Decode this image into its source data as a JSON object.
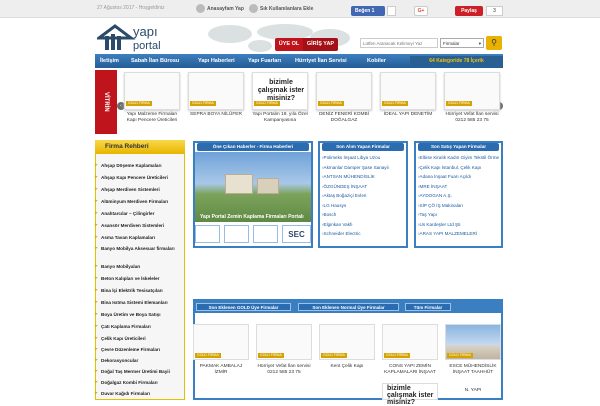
{
  "top": {
    "date": "27 Ağustos 2017 - Hoşgeldiniz",
    "homepage": "Anasayfam Yap",
    "favorites": "Sık Kullanılanlara Ekle",
    "fb_like": "Beğen 1",
    "fb_count": "",
    "gplus": "G+",
    "pin": "Paylaş",
    "pin_count": "3"
  },
  "header": {
    "uye": "ÜYE OL",
    "giris": "GİRİŞ YAP",
    "search_placeholder": "Lütfen Aranacak Kelimeyi Yaz",
    "search_select": "Firmalar",
    "category_count": "64 Kategoride 78 İçerik"
  },
  "nav": [
    "İletişim",
    "Sabah İlan Bürosu",
    "Yapı Haberleri",
    "Yapı Fuarları",
    "Hürriyet İlan Servisi",
    "Kobiler"
  ],
  "vitrin": {
    "label": "VİTRİN",
    "items": [
      {
        "name": "Yapı Malzeme Firmaları Kapı Pencere Üreticileri"
      },
      {
        "name": "SEPRA BOYA NİLÜFER"
      },
      {
        "name": "Yapı Portalın 19. yıla Özel Kampanyasına"
      },
      {
        "name": "DENİZ FENERİ KOMBİ DOĞALGAZ"
      },
      {
        "name": "İDEAL YAPI DENETİM"
      },
      {
        "name": "Hürriyet Vefat İlan servisi 0212 585 23 75"
      }
    ],
    "ad_text": "bizimle çalışmak ister misiniz?",
    "badge": "GOLD FİRMA"
  },
  "sidebar": {
    "title": "Firma Rehberi",
    "items": [
      "Ahşap Döşeme Kaplamaları",
      "Ahşap Kapı Pencere Üreticileri",
      "Ahşap Merdiven Sistemleri",
      "Alüminyum Merdiven Firmaları",
      "Anahtarcılar – Çilingirler",
      "Asansör Merdiven Sistemleri",
      "Asma Tavan Kaplamaları",
      "Banyo Mobilya Aksesuar firmaları",
      "Banyo Mobilyaları",
      "Beton Kalıpları ve İskeleler",
      "Bina İçi Elektrik Tesisatçıları",
      "Bina Isıtma Sistemi Elemanları",
      "Boya Üretim ve Boya Satışı",
      "Çatı Kaplama Firmaları",
      "Çelik Kapı Üreticileri",
      "Çevre Düzenleme Firmaları",
      "Dekorasyoncular",
      "Doğal Taş Mermer Üretimi Bayii",
      "Doğalgaz Kombi Firmaları",
      "Duvar Kağıdı Firmaları"
    ]
  },
  "news": {
    "title": "Öne Çıkan Haberler - Firma Haberleri",
    "caption": "Yapı Portal Zemin Kaplama Firmaları Portalı",
    "thumbs": [
      "",
      "",
      "",
      "SEC"
    ]
  },
  "box_alim": {
    "title": "Son Alım Yapan Firmalar",
    "items": [
      "Polimeks İnşaat Libya Uzou",
      "Akmanlar Damper Şase Sanayii",
      "ANTSAN MÜHENDİSLİK",
      "ÖZGÜNDEŞ İNŞAAT",
      "Aktaş Boğaziçi Evleri",
      "LG Hausys",
      "Bosch",
      "Elginkan Vakfı",
      "Schneider Electric"
    ]
  },
  "box_satis": {
    "title": "Son Satış Yapan Firmalar",
    "items": [
      "Elbise Kiralık Kadın Giyim Tekstil Örme Fabrikası",
      "Çelik Kapı İstanbul, Çelik Kapı",
      "Adana İnşaat Fuarı Açıldı",
      "MRE İNŞAAT",
      "AYDOGAN A.Ş.",
      "SİP ÇÖ İŞ Makinaları",
      "Taş Yapı",
      "Us Kardeşler Ltd Şti",
      "ARAS YAPI MALZEMELERİ"
    ]
  },
  "firmalar": {
    "tabs": [
      "Son Eklenen GOLD Üye Firmalar",
      "Son Eklenen Normal Üye Firmalar",
      "Tüm Firmalar"
    ],
    "items": [
      {
        "name": "PAKMAK AMBALAJ İZMİR"
      },
      {
        "name": "Hürriyet Vefat İlan servisi 0212 585 23 75"
      },
      {
        "name": "Kent Çelik Kapı"
      },
      {
        "name": "CONS YAPI ZEMİN KAPLAMALARI İNŞAAT"
      },
      {
        "name": "ESCE MÜHENDİSLİK İNŞAAT TAAHHÜT"
      }
    ],
    "badge": "GOLD FİRMA",
    "extra_name": "N. YAPI"
  },
  "colors": {
    "accent": "#3a7fc2",
    "red": "#c0141c",
    "gold": "#e7b500"
  }
}
